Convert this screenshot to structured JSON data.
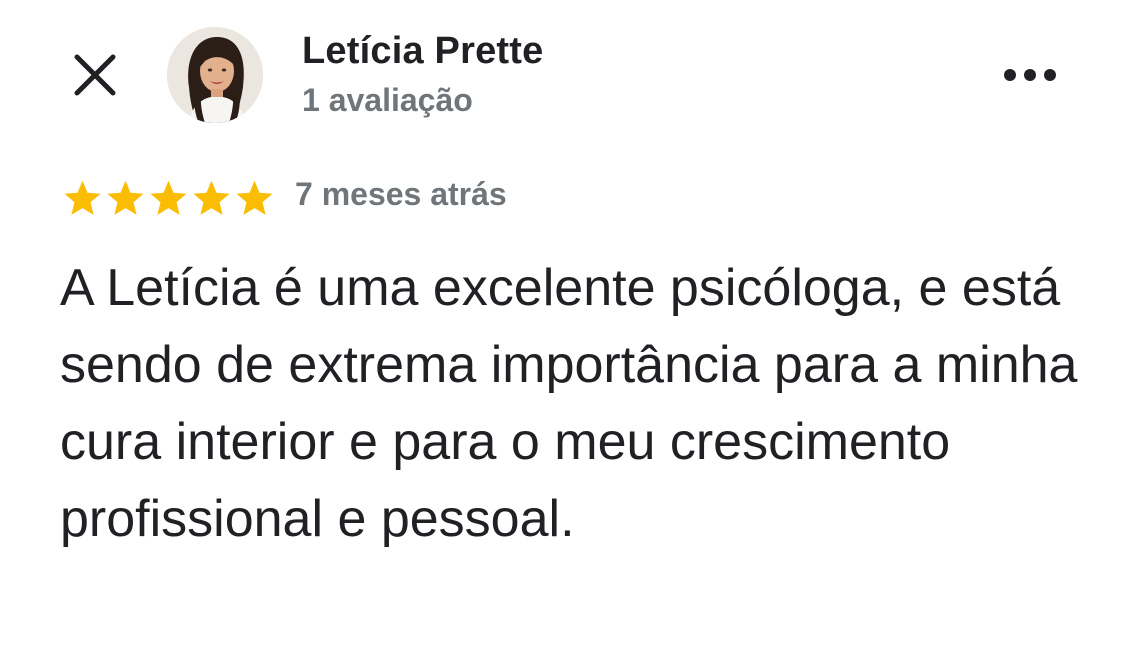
{
  "header": {
    "close_icon": "close-icon",
    "more_icon": "more-options-icon"
  },
  "reviewer": {
    "name": "Letícia Prette",
    "review_count": "1 avaliação",
    "avatar": "avatar-photo"
  },
  "review": {
    "rating": 5,
    "rating_max": 5,
    "date": "7 meses atrás",
    "text": "A Letícia é uma excelente psicóloga, e está sendo de extrema importância para a minha cura interior e para o meu crescimento profissional e pessoal."
  },
  "colors": {
    "star": "#fbbc04",
    "primary_text": "#202124",
    "secondary_text": "#70757a"
  }
}
